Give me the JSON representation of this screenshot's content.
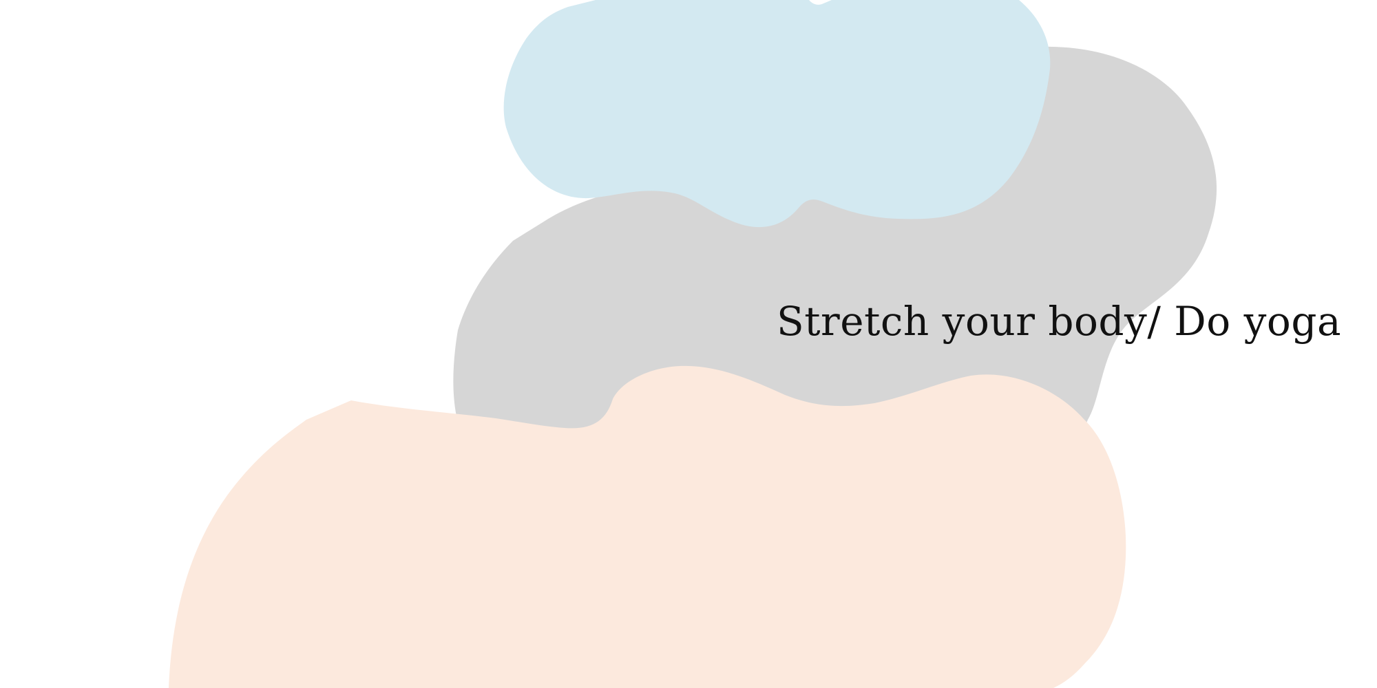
{
  "headline": "Stretch your body/ Do yoga",
  "colors": {
    "background": "#ffffff",
    "grey_blob": "#d6d6d6",
    "blue_blob": "#d3e9f1",
    "peach_blob": "#fce9dd",
    "text": "#111111"
  }
}
